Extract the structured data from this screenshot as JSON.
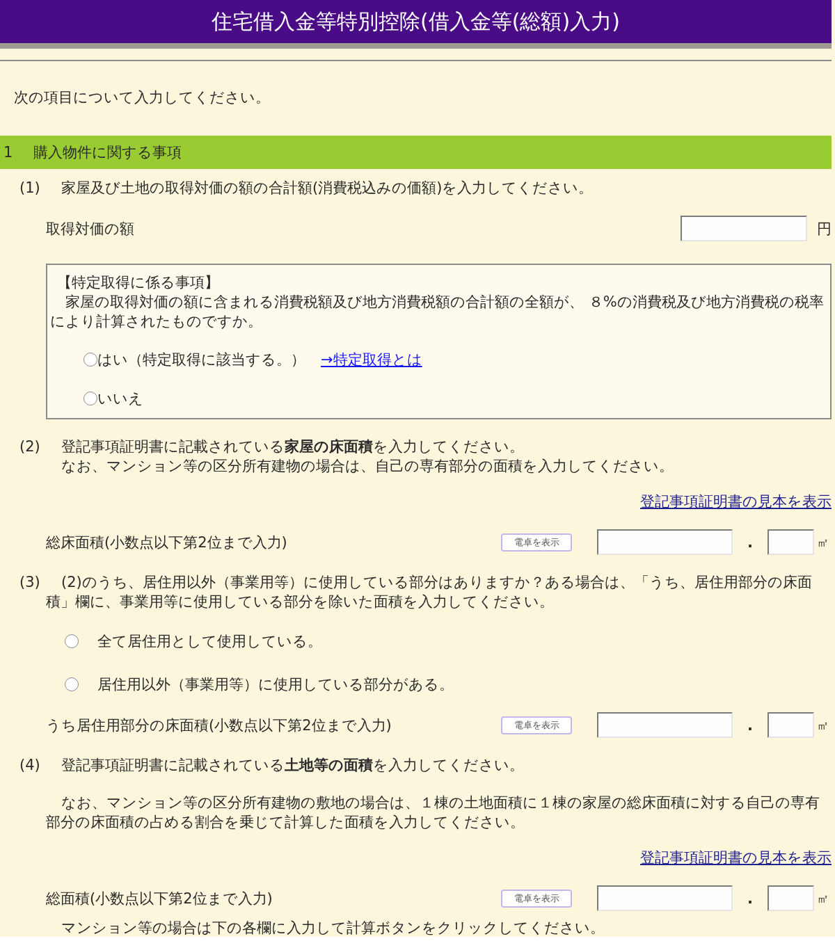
{
  "title": "住宅借入金等特別控除(借入金等(総額)入力)",
  "intro": "次の項目について入力してください。",
  "section": {
    "number": "1",
    "title": "購入物件に関する事項"
  },
  "items": [
    {
      "number": "(1)",
      "heading": "家屋及び土地の取得対価の額の合計額(消費税込みの価額)を入力してください。",
      "blocks": [
        {
          "kind": "amount",
          "label": "取得対価の額",
          "unit": "円"
        },
        {
          "kind": "box",
          "title": "【特定取得に係る事項】",
          "text": "家屋の取得対価の額に含まれる消費税額及び地方消費税額の合計額の全額が、 ８%の消費税及び地方消費税の税率により計算されたものですか。",
          "options": [
            {
              "label": "はい（特定取得に該当する。）",
              "selected": false,
              "link": "→特定取得とは"
            },
            {
              "label": "いいえ",
              "selected": false
            }
          ]
        }
      ]
    },
    {
      "number": "(2)",
      "heading": "登記事項証明書に記載されている**家屋の床面積**を入力してください。",
      "blocks": [
        {
          "kind": "line",
          "text": "なお、マンション等の区分所有建物の場合は、自己の専有部分の面積を入力してください。"
        },
        {
          "kind": "link",
          "text": "登記事項証明書の見本を表示"
        },
        {
          "kind": "area",
          "label": "総床面積(小数点以下第2位まで入力)",
          "button": "電卓を表示",
          "separator": ".",
          "unit": "㎡"
        }
      ]
    },
    {
      "number": "(3)",
      "heading": "(2)のうち、居住用以外（事業用等）に使用している部分はありますか？ある場合は、「うち、居住用部分の床面積」欄に、事業用等に使用している部分を除いた面積を入力してください。",
      "blocks": [
        {
          "kind": "radios",
          "options": [
            {
              "label": "全て居住用として使用している。",
              "selected": false
            },
            {
              "label": "居住用以外（事業用等）に使用している部分がある。",
              "selected": false
            }
          ]
        },
        {
          "kind": "area",
          "label": "うち居住用部分の床面積(小数点以下第2位まで入力)",
          "button": "電卓を表示",
          "separator": ".",
          "unit": "㎡"
        }
      ]
    },
    {
      "number": "(4)",
      "heading": "登記事項証明書に記載されている**土地等の面積**を入力してください。",
      "blocks": [
        {
          "kind": "note",
          "text": "なお、マンション等の区分所有建物の敷地の場合は、１棟の土地面積に１棟の家屋の総床面積に対する自己の専有部分の床面積の占める割合を乗じて計算した面積を入力してください。"
        },
        {
          "kind": "link",
          "text": "登記事項証明書の見本を表示"
        },
        {
          "kind": "area",
          "label": "総面積(小数点以下第2位まで入力)",
          "button": "電卓を表示",
          "separator": ".",
          "unit": "㎡"
        }
      ]
    }
  ],
  "footer_note": "マンション等の場合は下の各欄に入力して計算ボタンをクリックしてください。"
}
